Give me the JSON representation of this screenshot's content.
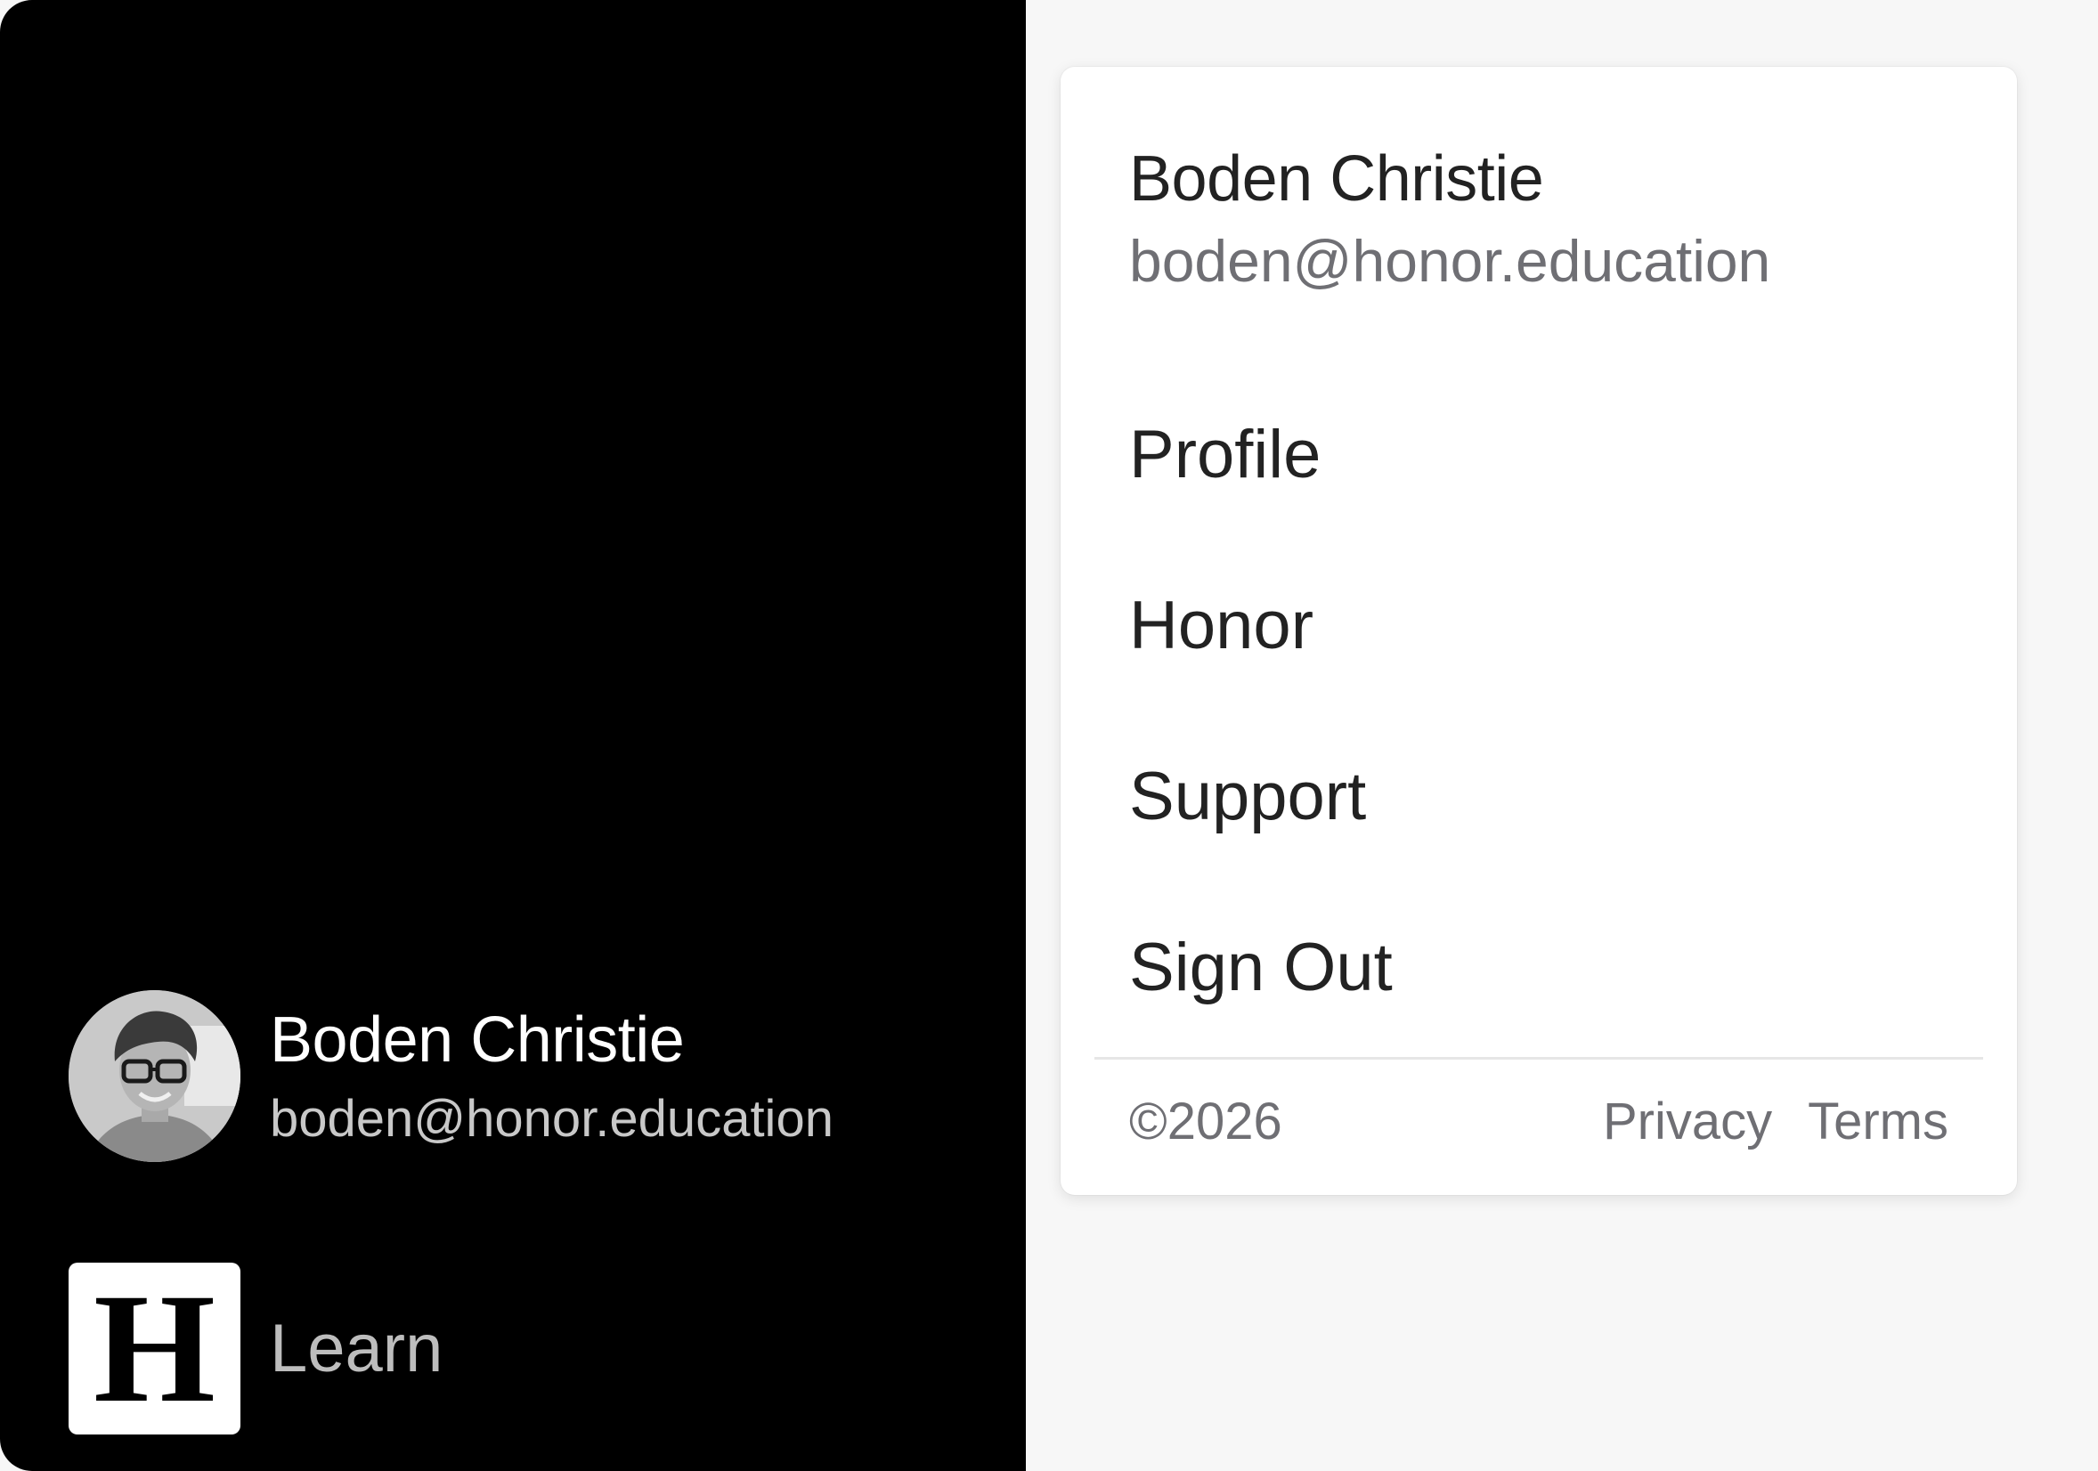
{
  "sidebar": {
    "user": {
      "name": "Boden Christie",
      "email": "boden@honor.education",
      "avatar_icon": "user-photo-avatar"
    },
    "brand": {
      "logo_letter": "H",
      "label": "Learn"
    },
    "background_color": "#000000"
  },
  "account_menu": {
    "header": {
      "name": "Boden Christie",
      "email": "boden@honor.education"
    },
    "items": [
      {
        "label": "Profile"
      },
      {
        "label": "Honor"
      },
      {
        "label": "Support"
      },
      {
        "label": "Sign Out"
      }
    ],
    "footer": {
      "copyright": "©2026",
      "links": [
        {
          "label": "Privacy"
        },
        {
          "label": "Terms"
        }
      ]
    }
  }
}
